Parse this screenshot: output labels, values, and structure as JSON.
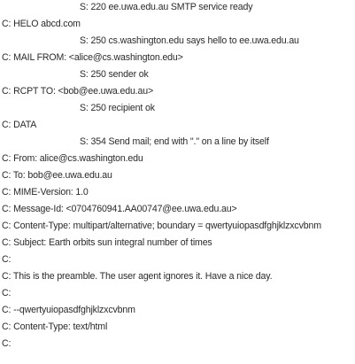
{
  "transcript": {
    "lines": [
      {
        "speaker": "server",
        "text": "S: 220 ee.uwa.edu.au SMTP service ready"
      },
      {
        "speaker": "client",
        "text": "C: HELO abcd.com"
      },
      {
        "speaker": "server",
        "text": "S: 250 cs.washington.edu says hello to ee.uwa.edu.au"
      },
      {
        "speaker": "client",
        "text": "C: MAIL FROM: <alice@cs.washington.edu>"
      },
      {
        "speaker": "server",
        "text": "S: 250 sender ok"
      },
      {
        "speaker": "client",
        "text": "C: RCPT TO: <bob@ee.uwa.edu.au>"
      },
      {
        "speaker": "server",
        "text": "S: 250 recipient ok"
      },
      {
        "speaker": "client",
        "text": "C: DATA"
      },
      {
        "speaker": "server",
        "text": "S: 354 Send mail; end with \".\" on a line by itself"
      },
      {
        "speaker": "client",
        "text": "C: From: alice@cs.washington.edu"
      },
      {
        "speaker": "client",
        "text": "C: To: bob@ee.uwa.edu.au"
      },
      {
        "speaker": "client",
        "text": "C: MIME-Version: 1.0"
      },
      {
        "speaker": "client",
        "text": "C: Message-Id: <0704760941.AA00747@ee.uwa.edu.au>"
      },
      {
        "speaker": "client",
        "text": "C: Content-Type: multipart/alternative; boundary = qwertyuiopasdfghjklzxcvbnm"
      },
      {
        "speaker": "client",
        "text": "C: Subject: Earth orbits sun integral number of times"
      },
      {
        "speaker": "client",
        "text": "C:"
      },
      {
        "speaker": "client",
        "text": "C: This is the preamble. The user agent ignores it. Have a nice day."
      },
      {
        "speaker": "client",
        "text": "C:"
      },
      {
        "speaker": "client",
        "text": "C: --qwertyuiopasdfghjklzxcvbnm"
      },
      {
        "speaker": "client",
        "text": "C: Content-Type: text/html"
      },
      {
        "speaker": "client",
        "text": "C:"
      }
    ]
  }
}
